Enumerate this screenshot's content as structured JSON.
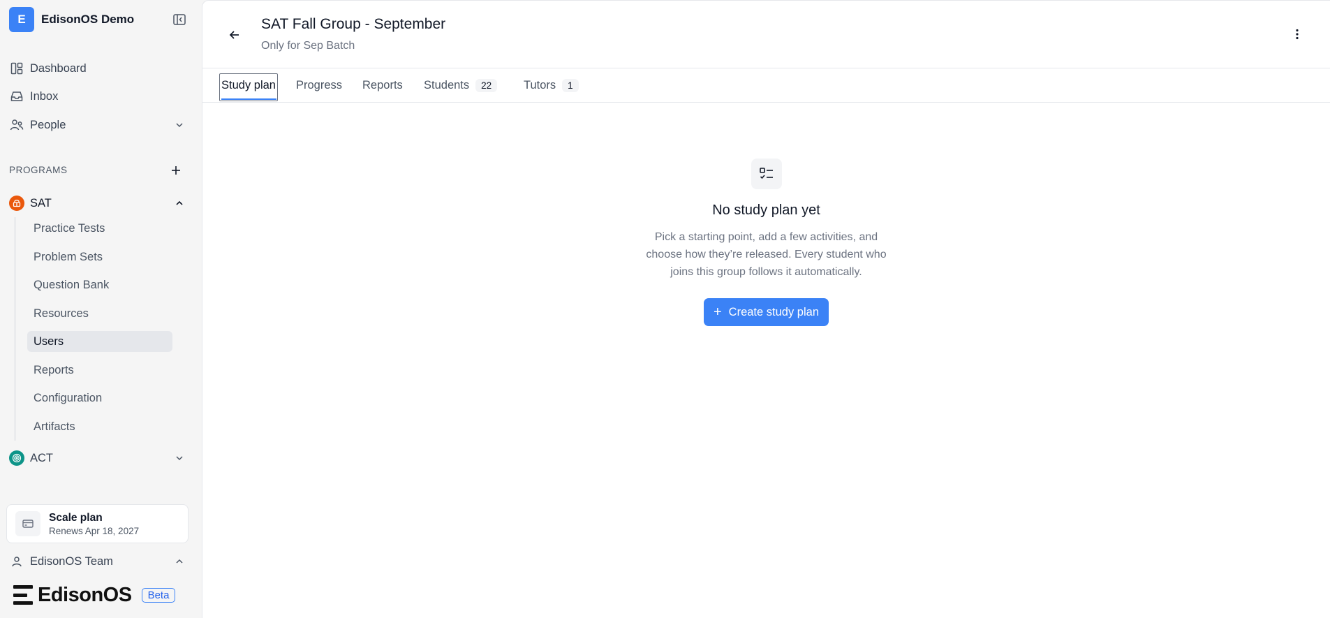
{
  "workspace": {
    "initial": "E",
    "name": "EdisonOS Demo"
  },
  "nav": {
    "dashboard": "Dashboard",
    "inbox": "Inbox",
    "people": "People"
  },
  "programs": {
    "section_label": "PROGRAMS",
    "sat": {
      "label": "SAT",
      "badge_color": "#ea580c",
      "items": [
        "Practice Tests",
        "Problem Sets",
        "Question Bank",
        "Resources",
        "Users",
        "Reports",
        "Configuration",
        "Artifacts"
      ],
      "active_item": "Users"
    },
    "act": {
      "label": "ACT",
      "badge_color": "#0d9488"
    }
  },
  "plan": {
    "title": "Scale plan",
    "renews": "Renews Apr 18, 2027"
  },
  "team": {
    "label": "EdisonOS Team"
  },
  "brand": {
    "name": "EdisonOS",
    "badge": "Beta"
  },
  "header": {
    "title": "SAT Fall Group - September",
    "subtitle": "Only for Sep Batch"
  },
  "tabs": [
    {
      "label": "Study plan",
      "active": true
    },
    {
      "label": "Progress"
    },
    {
      "label": "Reports"
    },
    {
      "label": "Students",
      "count": "22"
    },
    {
      "label": "Tutors",
      "count": "1"
    }
  ],
  "empty_state": {
    "icon": "checklist-icon",
    "title": "No study plan yet",
    "description": "Pick a starting point, add a few activities, and choose how they’re released. Every student who joins this group follows it automatically.",
    "button_label": "Create study plan"
  },
  "colors": {
    "accent": "#3b82f6",
    "active_nav_bg": "#e5e7eb"
  }
}
